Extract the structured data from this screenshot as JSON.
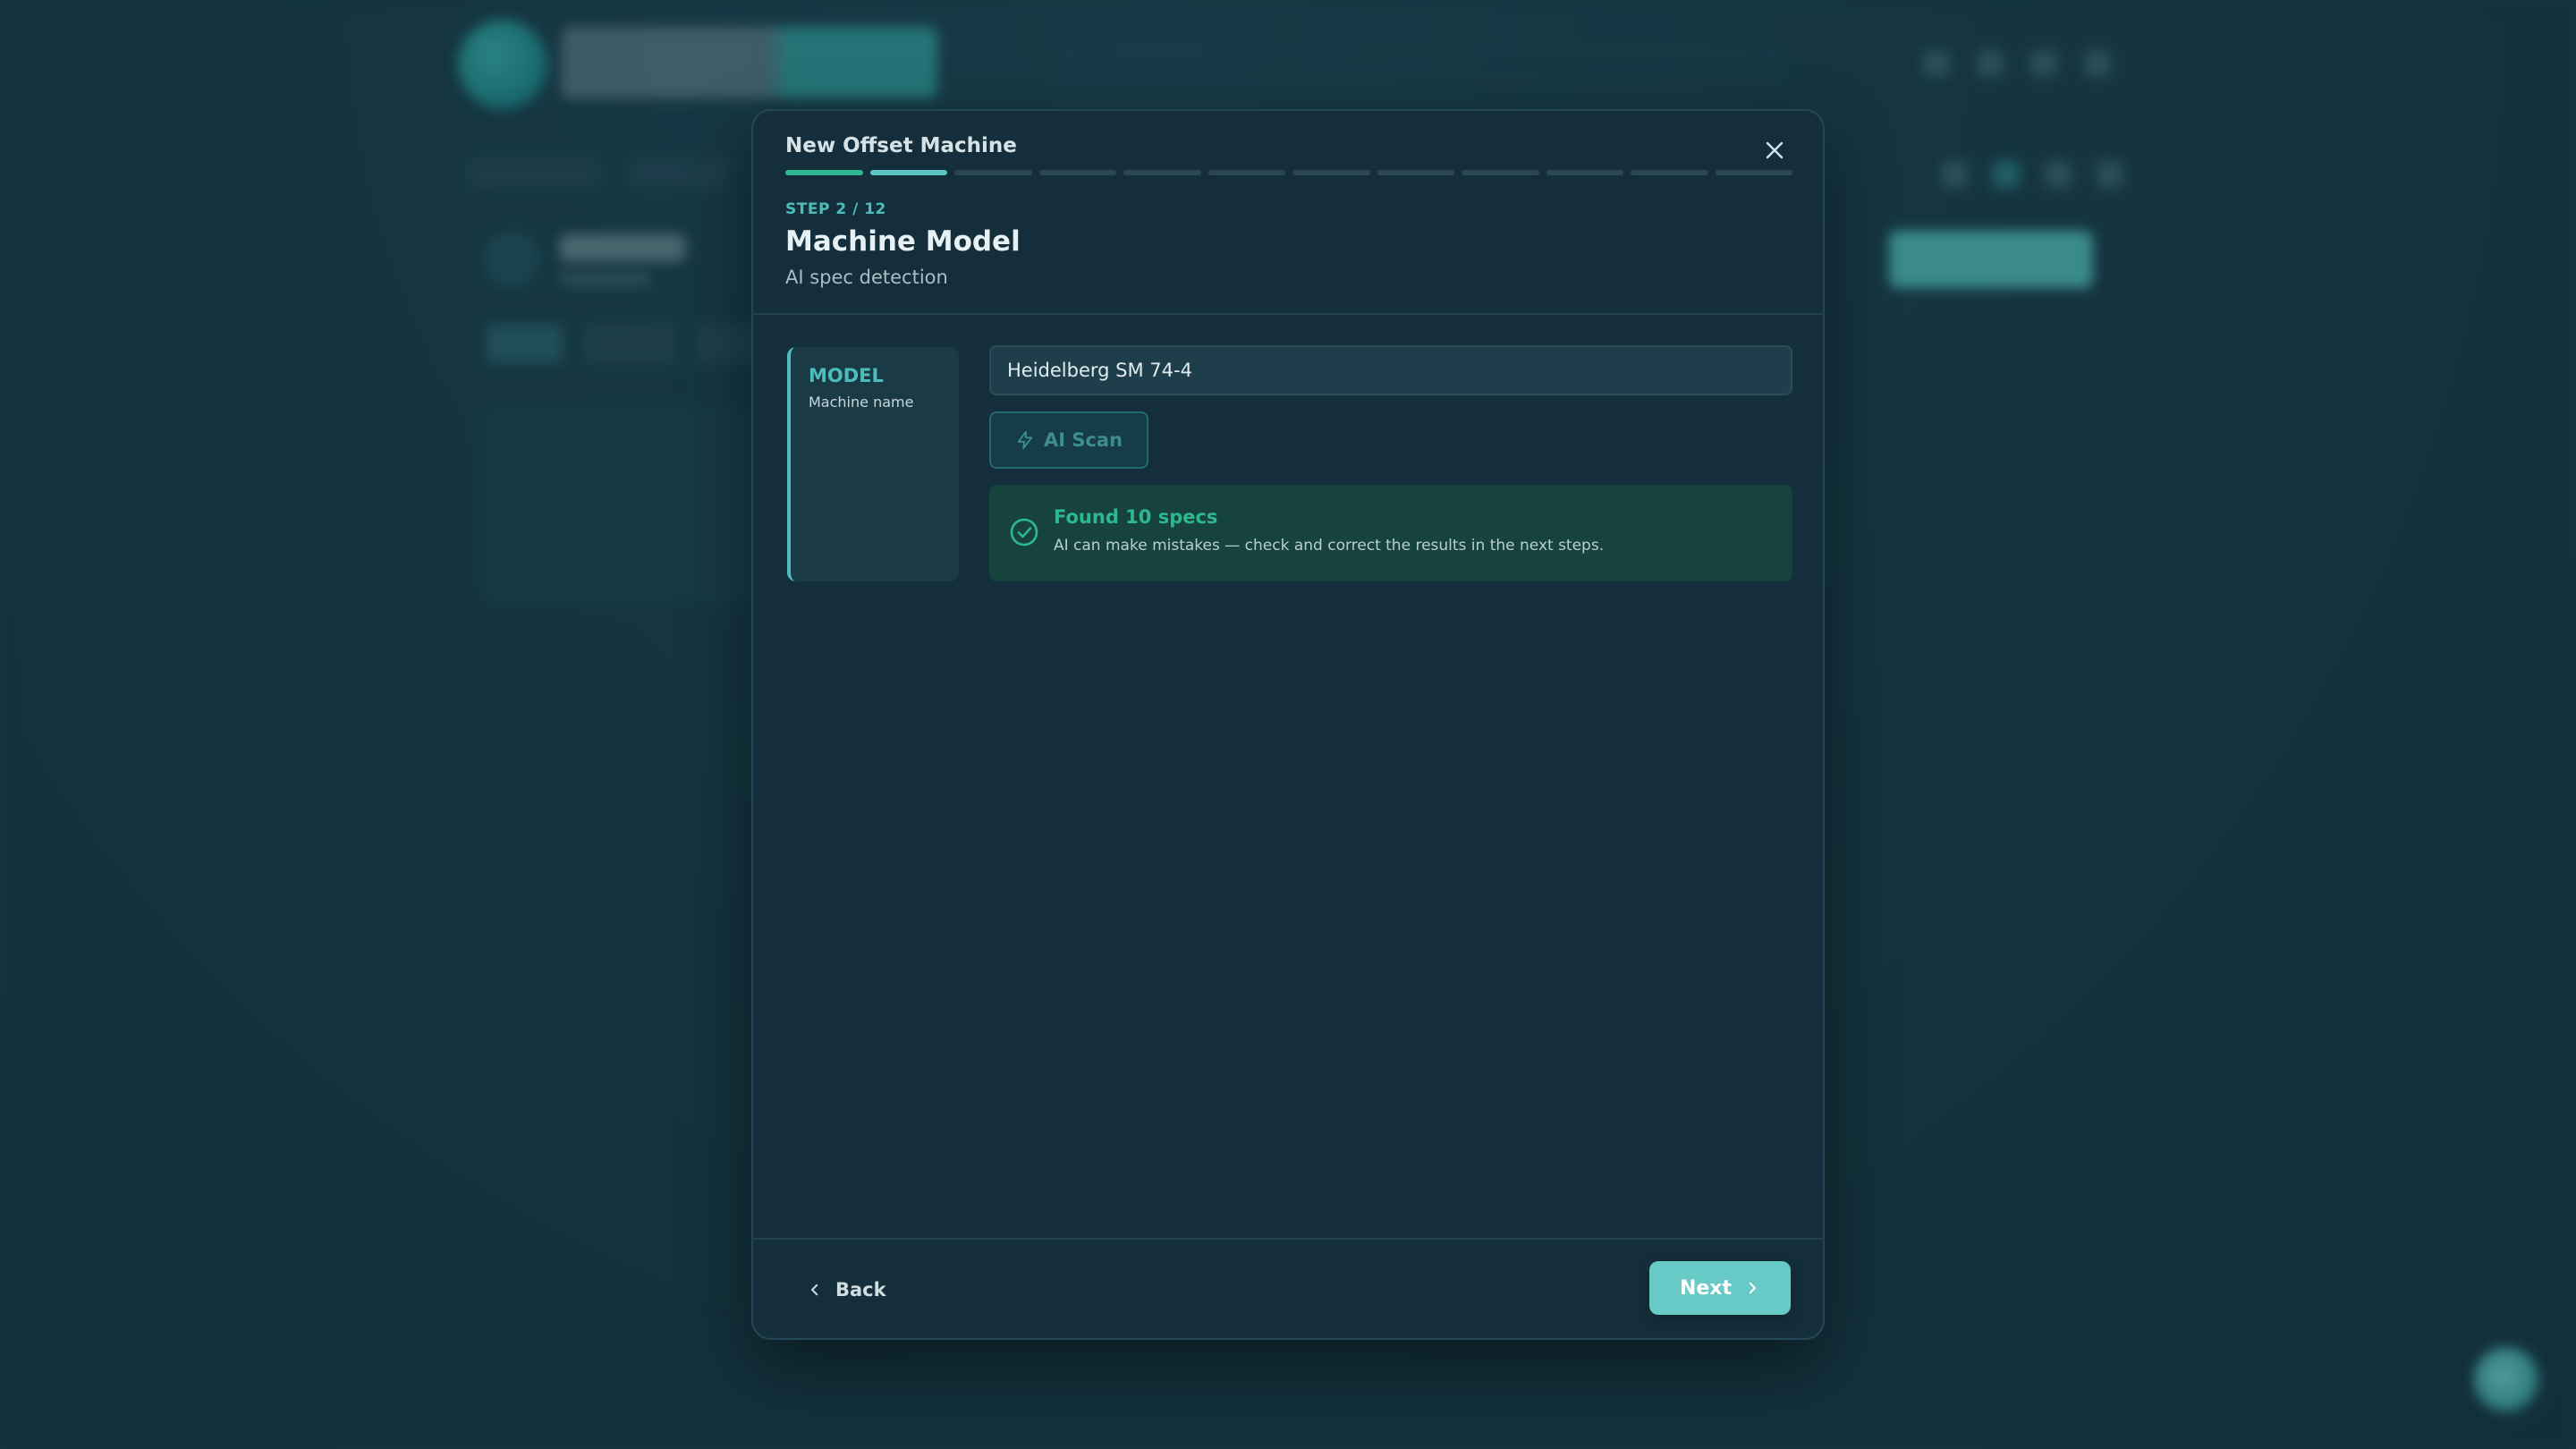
{
  "modal": {
    "title": "New Offset Machine",
    "progress": {
      "current": 2,
      "total": 12
    },
    "step_label": "STEP 2 / 12",
    "step_title": "Machine Model",
    "step_subtitle": "AI spec detection"
  },
  "side_card": {
    "key": "MODEL",
    "value": "Machine name"
  },
  "model_input": {
    "value": "Heidelberg SM 74-4"
  },
  "ai_scan": {
    "label": "AI Scan",
    "icon": "lightning-icon"
  },
  "result": {
    "icon": "check-circle-icon",
    "title": "Found 10 specs",
    "description": "AI can make mistakes — check and correct the results in the next steps."
  },
  "footer": {
    "back_label": "Back",
    "next_label": "Next"
  },
  "colors": {
    "accent": "#5bc6c4",
    "success": "#2fb78f",
    "modal_bg": "#142f3b",
    "page_bg": "#1b3f4c"
  }
}
